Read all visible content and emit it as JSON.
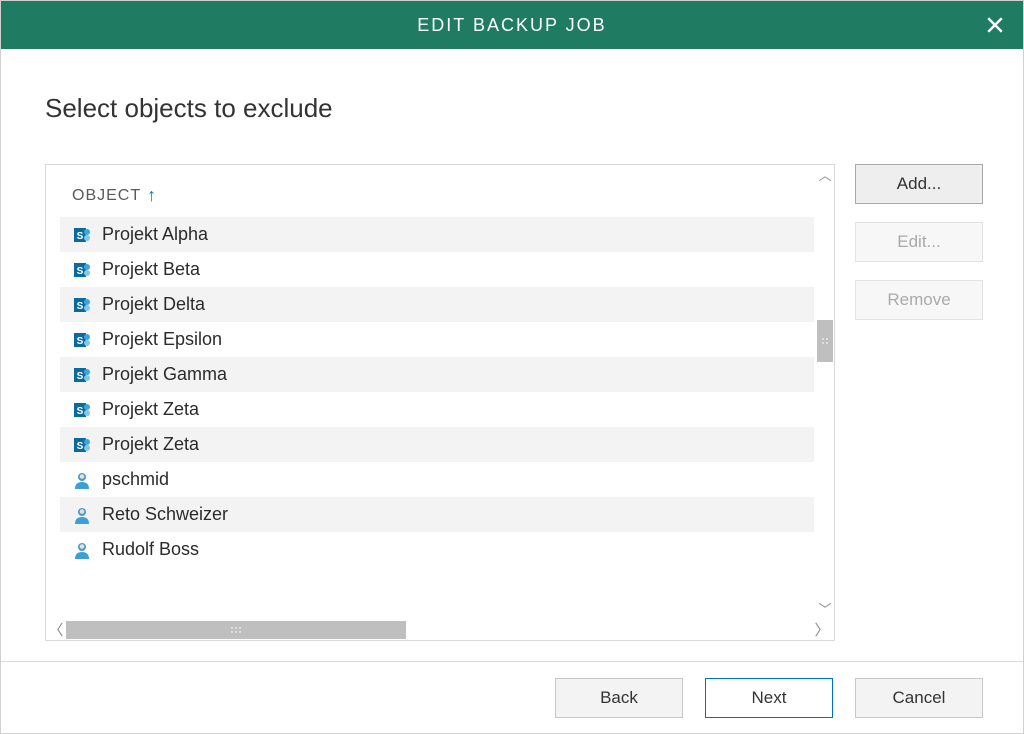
{
  "dialog": {
    "title": "EDIT BACKUP JOB",
    "heading": "Select objects to exclude"
  },
  "list": {
    "column_header": "OBJECT",
    "items": [
      {
        "icon": "sharepoint",
        "label": "Projekt Alpha"
      },
      {
        "icon": "sharepoint",
        "label": "Projekt Beta"
      },
      {
        "icon": "sharepoint",
        "label": "Projekt Delta"
      },
      {
        "icon": "sharepoint",
        "label": "Projekt Epsilon"
      },
      {
        "icon": "sharepoint",
        "label": "Projekt Gamma"
      },
      {
        "icon": "sharepoint",
        "label": "Projekt Zeta"
      },
      {
        "icon": "sharepoint",
        "label": "Projekt Zeta"
      },
      {
        "icon": "user",
        "label": "pschmid"
      },
      {
        "icon": "user",
        "label": "Reto Schweizer"
      },
      {
        "icon": "user",
        "label": "Rudolf Boss"
      }
    ]
  },
  "side_buttons": {
    "add": "Add...",
    "edit": "Edit...",
    "remove": "Remove"
  },
  "footer_buttons": {
    "back": "Back",
    "next": "Next",
    "cancel": "Cancel"
  }
}
